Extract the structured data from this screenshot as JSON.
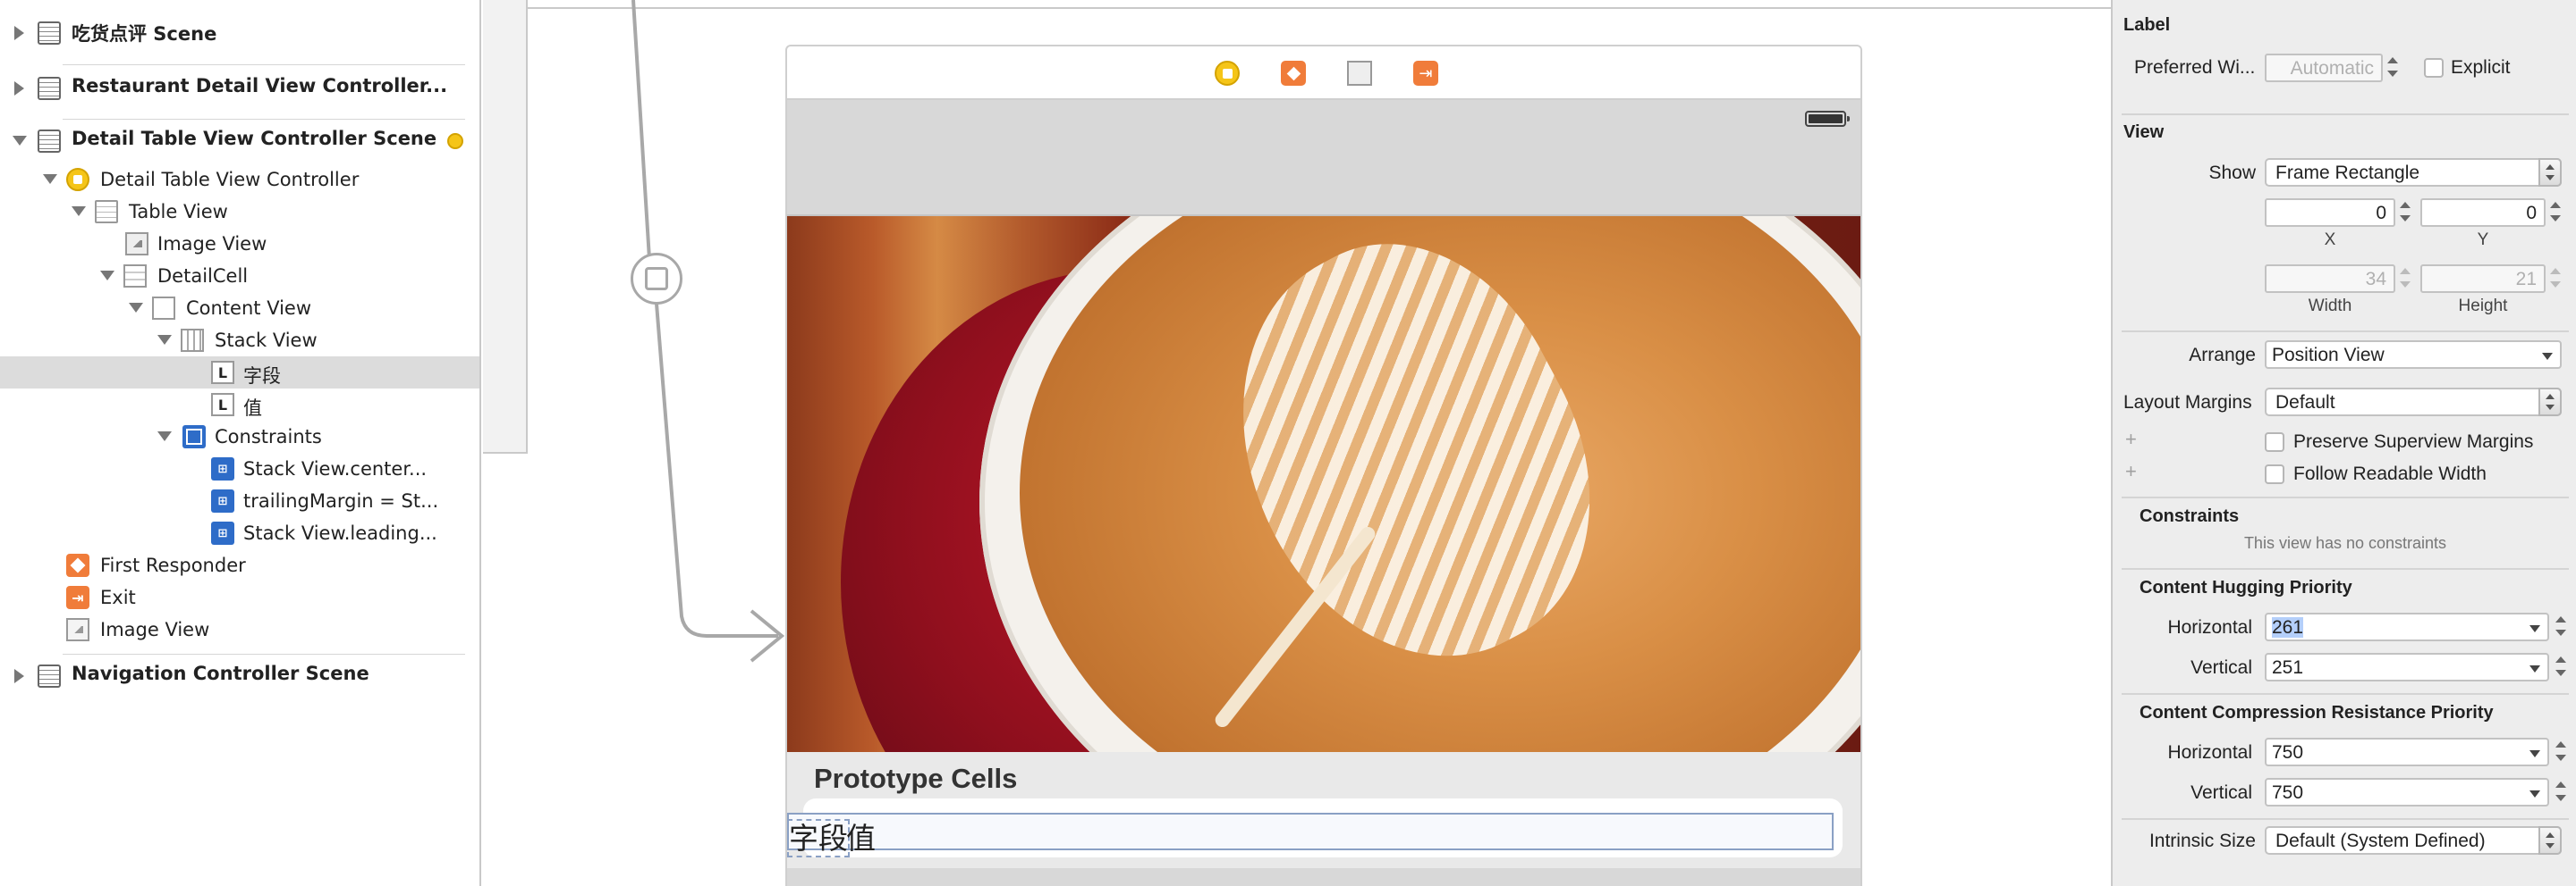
{
  "outline": {
    "rows": [
      {
        "label": "吃货点评 Scene"
      },
      {
        "label": "Restaurant Detail View Controller..."
      },
      {
        "label": "Detail Table View Controller Scene"
      },
      {
        "label": "Detail Table View Controller"
      },
      {
        "label": "Table View"
      },
      {
        "label": "Image View"
      },
      {
        "label": "DetailCell"
      },
      {
        "label": "Content View"
      },
      {
        "label": "Stack View"
      },
      {
        "label": "字段",
        "icon_text": "L"
      },
      {
        "label": "值",
        "icon_text": "L"
      },
      {
        "label": "Constraints"
      },
      {
        "label": "Stack View.center..."
      },
      {
        "label": "trailingMargin = St..."
      },
      {
        "label": "Stack View.leading..."
      },
      {
        "label": "First Responder"
      },
      {
        "label": "Exit"
      },
      {
        "label": "Image View"
      },
      {
        "label": "Navigation Controller Scene"
      }
    ],
    "selected_row": "字段"
  },
  "canvas": {
    "section_title": "Prototype Cells",
    "cell_field_label": "字段",
    "cell_value_label": "值"
  },
  "inspector": {
    "label_section": {
      "title": "Label",
      "preferred_width_label": "Preferred Wi...",
      "preferred_width_placeholder": "Automatic",
      "explicit_label": "Explicit"
    },
    "view_section": {
      "title": "View",
      "show_label": "Show",
      "show_value": "Frame Rectangle",
      "x_value": "0",
      "y_value": "0",
      "x_caption": "X",
      "y_caption": "Y",
      "width_value": "34",
      "height_value": "21",
      "width_caption": "Width",
      "height_caption": "Height",
      "arrange_label": "Arrange",
      "arrange_value": "Position View",
      "layout_margins_label": "Layout Margins",
      "layout_margins_value": "Default",
      "preserve_superview_margins": "Preserve Superview Margins",
      "follow_readable_width": "Follow Readable Width",
      "plus": "+"
    },
    "constraints_section": {
      "title": "Constraints",
      "empty_message": "This view has no constraints"
    },
    "hugging_section": {
      "title": "Content Hugging Priority",
      "horizontal_label": "Horizontal",
      "horizontal_value": "261",
      "vertical_label": "Vertical",
      "vertical_value": "251"
    },
    "compression_section": {
      "title": "Content Compression Resistance Priority",
      "horizontal_label": "Horizontal",
      "horizontal_value": "750",
      "vertical_label": "Vertical",
      "vertical_value": "750"
    },
    "intrinsic_size_label": "Intrinsic Size",
    "intrinsic_size_value": "Default (System Defined)"
  },
  "colors": {
    "selection": "#dcdcdc",
    "constraint_blue": "#2e6cc8",
    "view_controller_yellow": "#f5c518",
    "responder_orange": "#f07c3a",
    "text_highlight": "#b4cffa"
  }
}
